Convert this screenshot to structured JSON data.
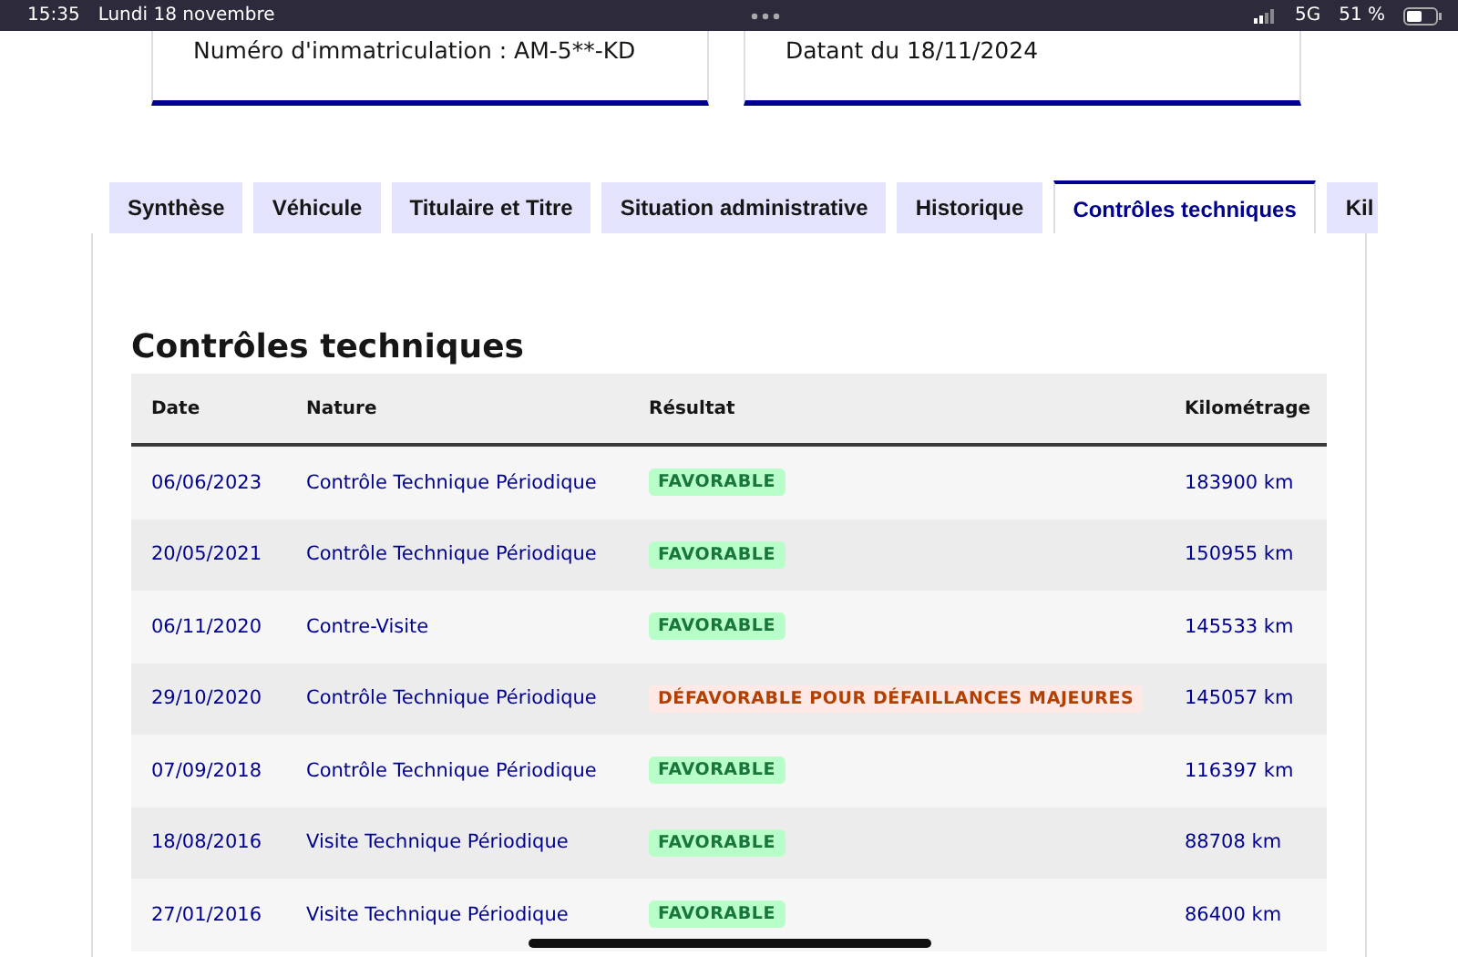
{
  "status_bar": {
    "time": "15:35",
    "date": "Lundi 18 novembre",
    "network": "5G",
    "battery": "51 %"
  },
  "cards": [
    {
      "text": "Numéro d'immatriculation : AM-5**-KD"
    },
    {
      "text": "Datant du 18/11/2024"
    }
  ],
  "tabs": [
    {
      "label": "Synthèse",
      "selected": false
    },
    {
      "label": "Véhicule",
      "selected": false
    },
    {
      "label": "Titulaire et Titre",
      "selected": false
    },
    {
      "label": "Situation administrative",
      "selected": false
    },
    {
      "label": "Historique",
      "selected": false
    },
    {
      "label": "Contrôles techniques",
      "selected": true
    },
    {
      "label": "Kil",
      "selected": false
    }
  ],
  "section_title": "Contrôles techniques",
  "table": {
    "columns": [
      "Date",
      "Nature",
      "Résultat",
      "Kilométrage"
    ],
    "rows": [
      {
        "date": "06/06/2023",
        "nature": "Contrôle Technique Périodique",
        "result": "FAVORABLE",
        "kind": "success",
        "mileage": "183900 km"
      },
      {
        "date": "20/05/2021",
        "nature": "Contrôle Technique Périodique",
        "result": "FAVORABLE",
        "kind": "success",
        "mileage": "150955 km"
      },
      {
        "date": "06/11/2020",
        "nature": "Contre-Visite",
        "result": "FAVORABLE",
        "kind": "success",
        "mileage": "145533 km"
      },
      {
        "date": "29/10/2020",
        "nature": "Contrôle Technique Périodique",
        "result": "DÉFAVORABLE POUR DÉFAILLANCES MAJEURES",
        "kind": "error",
        "mileage": "145057 km"
      },
      {
        "date": "07/09/2018",
        "nature": "Contrôle Technique Périodique",
        "result": "FAVORABLE",
        "kind": "success",
        "mileage": "116397 km"
      },
      {
        "date": "18/08/2016",
        "nature": "Visite Technique Périodique",
        "result": "FAVORABLE",
        "kind": "success",
        "mileage": "88708 km"
      },
      {
        "date": "27/01/2016",
        "nature": "Visite Technique Périodique",
        "result": "FAVORABLE",
        "kind": "success",
        "mileage": "86400 km"
      }
    ]
  }
}
